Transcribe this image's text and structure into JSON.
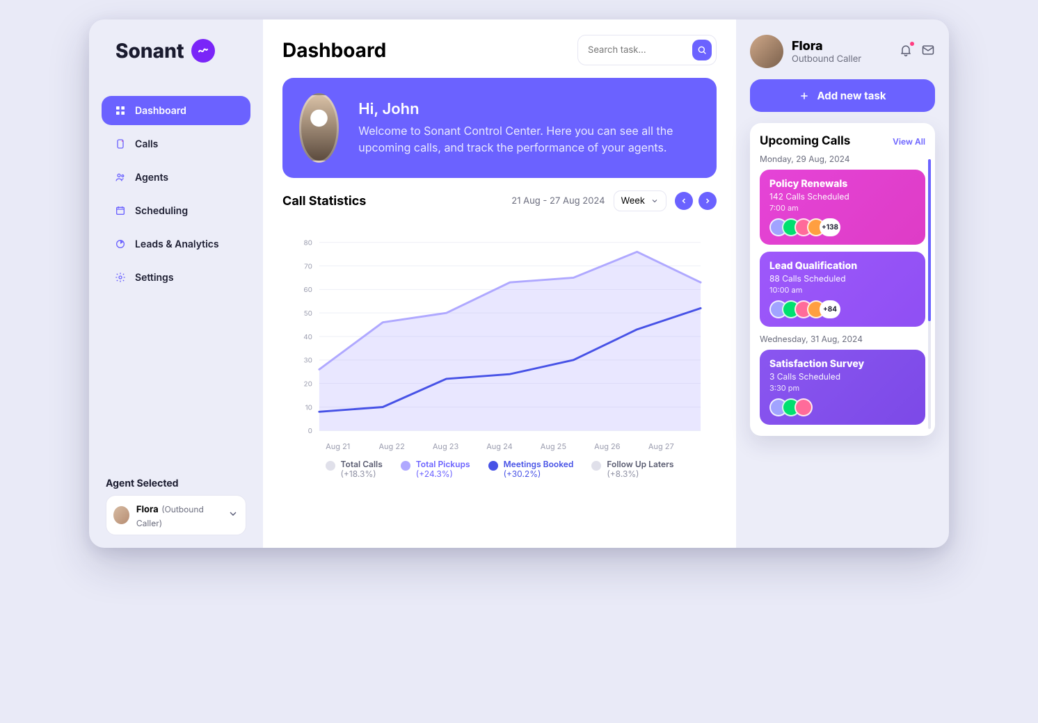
{
  "brand": {
    "name": "Sonant"
  },
  "nav": {
    "items": [
      {
        "label": "Dashboard"
      },
      {
        "label": "Calls"
      },
      {
        "label": "Agents"
      },
      {
        "label": "Scheduling"
      },
      {
        "label": "Leads & Analytics"
      },
      {
        "label": "Settings"
      }
    ]
  },
  "agent_selected": {
    "heading": "Agent Selected",
    "name": "Flora",
    "role": "(Outbound Caller)"
  },
  "header": {
    "title": "Dashboard",
    "search_placeholder": "Search task..."
  },
  "hero": {
    "greeting": "Hi, John",
    "description": "Welcome to Sonant Control Center. Here you can see all the upcoming calls, and track the performance of your agents."
  },
  "stats": {
    "title": "Call Statistics",
    "range": "21 Aug - 27 Aug 2024",
    "granularity": "Week",
    "legend": [
      {
        "label": "Total Calls",
        "delta": "(+18.3%)",
        "active": false
      },
      {
        "label": "Total Pickups",
        "delta": "(+24.3%)",
        "active": "brand"
      },
      {
        "label": "Meetings Booked",
        "delta": "(+30.2%)",
        "active": "blue"
      },
      {
        "label": "Follow Up Laters",
        "delta": "(+8.3%)",
        "active": false
      }
    ]
  },
  "chart_data": {
    "type": "line",
    "categories": [
      "Aug 21",
      "Aug 22",
      "Aug 23",
      "Aug 24",
      "Aug 25",
      "Aug 26",
      "Aug 27"
    ],
    "xlabel": "",
    "ylabel": "",
    "ylim": [
      0,
      80
    ],
    "yticks": [
      0,
      10,
      20,
      30,
      40,
      50,
      60,
      70,
      80
    ],
    "series": [
      {
        "name": "Total Pickups",
        "color": "#AFA8FF",
        "fill": true,
        "values": [
          26,
          46,
          50,
          63,
          65,
          76,
          63
        ]
      },
      {
        "name": "Meetings Booked",
        "color": "#4752E6",
        "fill": false,
        "values": [
          8,
          10,
          22,
          24,
          30,
          43,
          52
        ]
      }
    ]
  },
  "profile": {
    "name": "Flora",
    "role": "Outbound Caller"
  },
  "add_task": {
    "label": "Add new task"
  },
  "upcoming": {
    "title": "Upcoming Calls",
    "view_all": "View All",
    "groups": [
      {
        "date": "Monday, 29 Aug, 2024",
        "cards": [
          {
            "title": "Policy Renewals",
            "subtitle": "142 Calls Scheduled",
            "time": "7:00 am",
            "overflow": "+138",
            "style": "pink"
          },
          {
            "title": "Lead Qualification",
            "subtitle": "88 Calls Scheduled",
            "time": "10:00 am",
            "overflow": "+84",
            "style": "violet"
          }
        ]
      },
      {
        "date": "Wednesday, 31 Aug, 2024",
        "cards": [
          {
            "title": "Satisfaction Survey",
            "subtitle": "3 Calls Scheduled",
            "time": "3:30 pm",
            "overflow": null,
            "style": "violet2"
          }
        ]
      }
    ]
  }
}
